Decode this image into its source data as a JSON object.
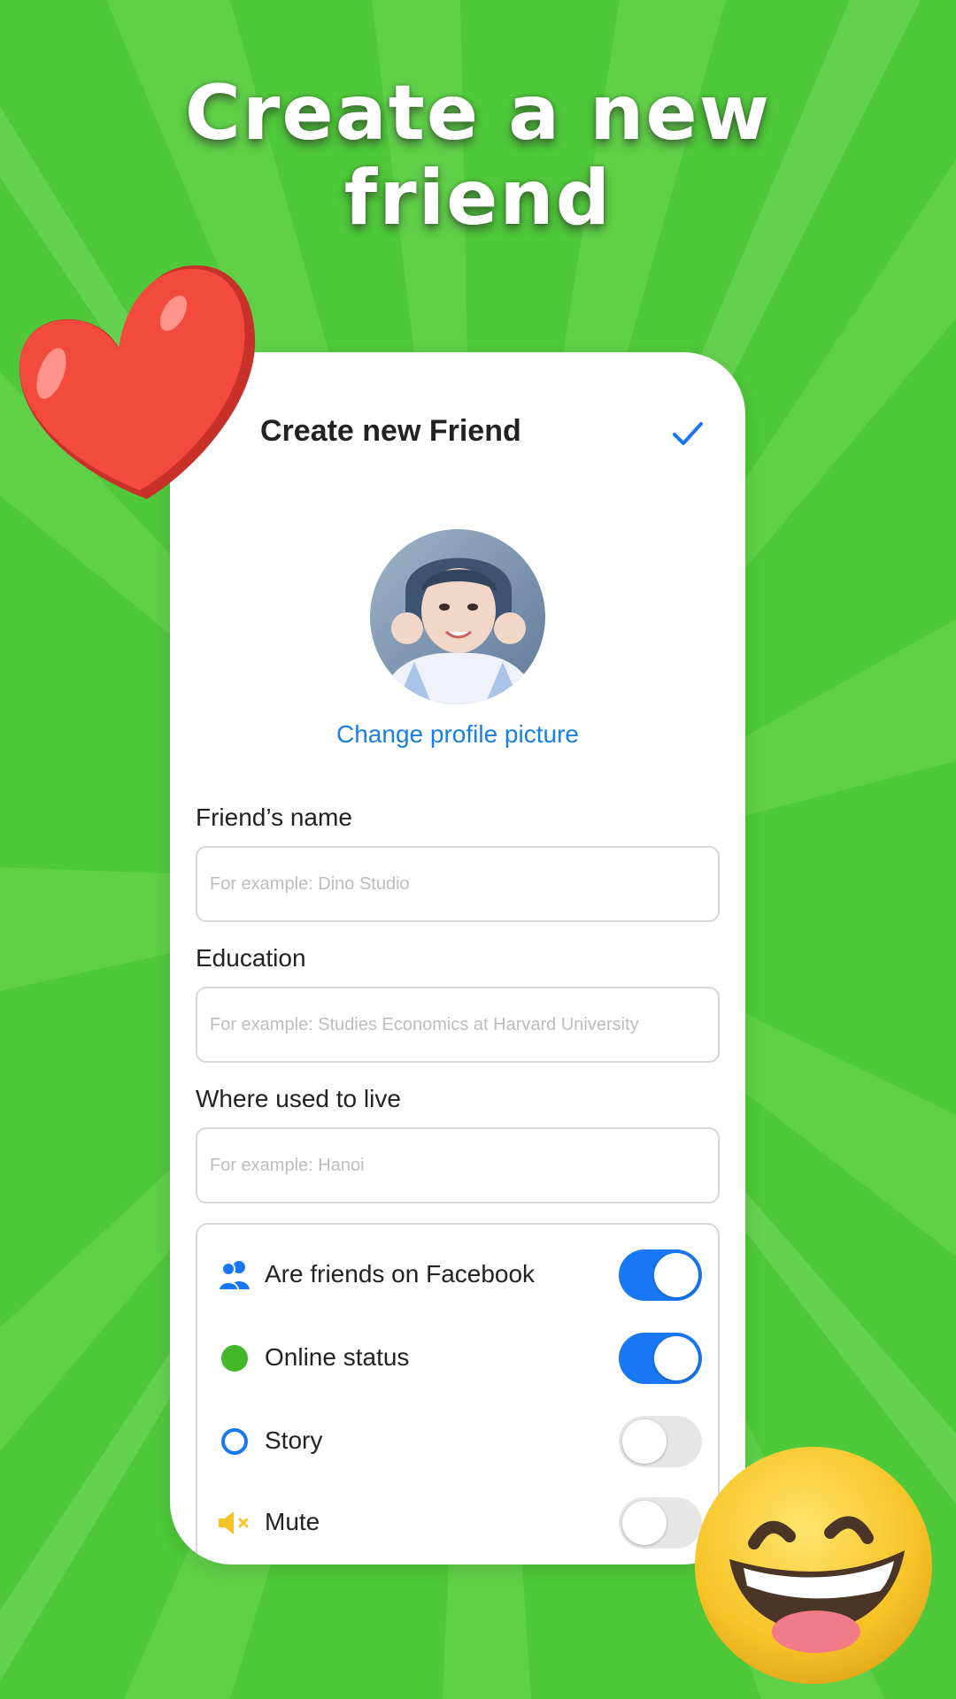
{
  "headline": {
    "line1": "Create a new",
    "line2": "friend"
  },
  "screen": {
    "title": "Create new Friend",
    "confirm_icon": "checkmark-icon",
    "change_picture_label": "Change profile picture",
    "fields": [
      {
        "label": "Friend’s name",
        "value": "",
        "placeholder": "For example: Dino Studio"
      },
      {
        "label": "Education",
        "value": "",
        "placeholder": "For example: Studies Economics at Harvard University"
      },
      {
        "label": "Where used to live",
        "value": "",
        "placeholder": "For example: Hanoi"
      }
    ],
    "options": [
      {
        "label": "Are friends on Facebook",
        "icon": "friends-icon",
        "on": true
      },
      {
        "label": "Online status",
        "icon": "online-dot-icon",
        "on": true
      },
      {
        "label": "Story",
        "icon": "story-ring-icon",
        "on": false
      },
      {
        "label": "Mute",
        "icon": "mute-icon",
        "on": false
      }
    ]
  },
  "colors": {
    "background": "#52c93a",
    "accent_blue": "#1877f2",
    "link_blue": "#1a7fe0",
    "online_green": "#42b72a",
    "mute_yellow": "#f7c325"
  },
  "decorations": [
    "heart-sticker",
    "laughing-emoji-sticker"
  ]
}
